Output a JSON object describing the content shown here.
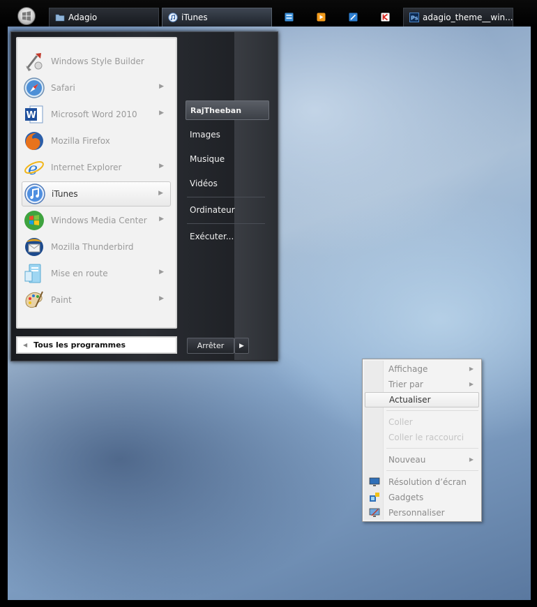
{
  "taskbar": {
    "buttons": [
      {
        "label": "Adagio",
        "icon": "folder-icon"
      },
      {
        "label": "iTunes",
        "icon": "itunes-icon"
      },
      {
        "label": "adagio_theme__win...",
        "icon": "photoshop-icon"
      }
    ],
    "quick_launch": [
      "windows-explorer-icon",
      "media-player-icon",
      "paint-icon",
      "app-k-icon"
    ]
  },
  "start_menu": {
    "programs": [
      {
        "label": "Windows Style Builder",
        "icon": "style-builder-icon",
        "has_submenu": false
      },
      {
        "label": "Safari",
        "icon": "safari-icon",
        "has_submenu": true
      },
      {
        "label": "Microsoft Word 2010",
        "icon": "word-icon",
        "has_submenu": true
      },
      {
        "label": "Mozilla Firefox",
        "icon": "firefox-icon",
        "has_submenu": false
      },
      {
        "label": "Internet Explorer",
        "icon": "internet-explorer-icon",
        "has_submenu": true
      },
      {
        "label": "iTunes",
        "icon": "itunes-icon",
        "has_submenu": true,
        "selected": true
      },
      {
        "label": "Windows Media Center",
        "icon": "media-center-icon",
        "has_submenu": true
      },
      {
        "label": "Mozilla Thunderbird",
        "icon": "thunderbird-icon",
        "has_submenu": false
      },
      {
        "label": "Mise en route",
        "icon": "getting-started-icon",
        "has_submenu": true
      },
      {
        "label": "Paint",
        "icon": "paint-icon",
        "has_submenu": true
      }
    ],
    "all_programs": "Tous les programmes",
    "places": {
      "user": "RajTheeban",
      "images": "Images",
      "music": "Musique",
      "videos": "Vidéos",
      "computer": "Ordinateur",
      "run": "Exécuter..."
    },
    "shutdown": "Arrêter",
    "submenu_arrow": "▶",
    "left_arrow": "◀"
  },
  "context_menu": {
    "items": [
      {
        "label": "Affichage",
        "has_submenu": true
      },
      {
        "label": "Trier par",
        "has_submenu": true
      },
      {
        "label": "Actualiser",
        "hover": true
      },
      {
        "label": "Coller",
        "disabled": true
      },
      {
        "label": "Coller le raccourci",
        "disabled": true
      },
      {
        "label": "Nouveau",
        "has_submenu": true
      },
      {
        "label": "Résolution d’écran",
        "icon": "screen-resolution-icon"
      },
      {
        "label": "Gadgets",
        "icon": "gadgets-icon"
      },
      {
        "label": "Personnaliser",
        "icon": "personalize-icon"
      }
    ]
  },
  "colors": {
    "taskbar": "#000000",
    "start_menu_dark": "#2a2d33",
    "programs_panel": "#f2f2f2",
    "context_menu": "#f3f3f3"
  }
}
